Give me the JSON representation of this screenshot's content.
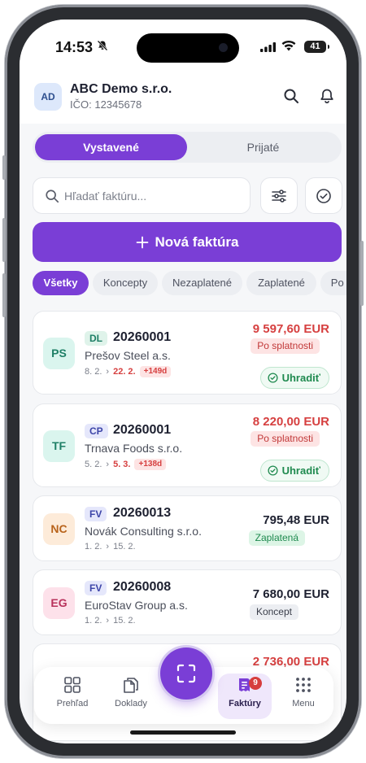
{
  "status_bar": {
    "time": "14:53",
    "battery": "41"
  },
  "header": {
    "avatar_initials": "AD",
    "company": "ABC Demo s.r.o.",
    "ico": "IČO: 12345678"
  },
  "tabs": [
    {
      "label": "Vystavené",
      "active": true
    },
    {
      "label": "Prijaté",
      "active": false
    }
  ],
  "search": {
    "placeholder": "Hľadať faktúru..."
  },
  "new_invoice_label": "Nová faktúra",
  "filters": [
    "Všetky",
    "Koncepty",
    "Nezaplatené",
    "Zaplatené",
    "Po splatnosti"
  ],
  "invoices": [
    {
      "initials": "PS",
      "type": "DL",
      "number": "20260001",
      "client": "Prešov Steel a.s.",
      "issued": "8. 2.",
      "due": "22. 2.",
      "overdue": "+149d",
      "amount": "9 597,60 EUR",
      "status": "Po splatnosti",
      "action": "Uhradiť"
    },
    {
      "initials": "TF",
      "type": "CP",
      "number": "20260001",
      "client": "Trnava Foods s.r.o.",
      "issued": "5. 2.",
      "due": "5. 3.",
      "overdue": "+138d",
      "amount": "8 220,00 EUR",
      "status": "Po splatnosti",
      "action": "Uhradiť"
    },
    {
      "initials": "NC",
      "type": "FV",
      "number": "20260013",
      "client": "Novák Consulting s.r.o.",
      "issued": "1. 2.",
      "due": "15. 2.",
      "amount": "795,48 EUR",
      "status": "Zaplatená"
    },
    {
      "initials": "EG",
      "type": "FV",
      "number": "20260008",
      "client": "EuroStav Group a.s.",
      "issued": "1. 2.",
      "due": "15. 2.",
      "amount": "7 680,00 EUR",
      "status": "Koncept"
    },
    {
      "amount": "2 736,00 EUR"
    }
  ],
  "bottom_nav": {
    "items": [
      {
        "label": "Prehľad",
        "icon": "grid-icon"
      },
      {
        "label": "Doklady",
        "icon": "documents-icon"
      },
      {
        "label": "Faktúry",
        "icon": "invoice-icon",
        "badge": "9",
        "active": true
      },
      {
        "label": "Menu",
        "icon": "menu-dots-icon"
      }
    ],
    "scan_icon": "scan-icon"
  },
  "colors": {
    "accent": "#7a3ed6",
    "overdue": "#d64040",
    "paid": "#1f8a4f",
    "draft": "#4e5260"
  }
}
